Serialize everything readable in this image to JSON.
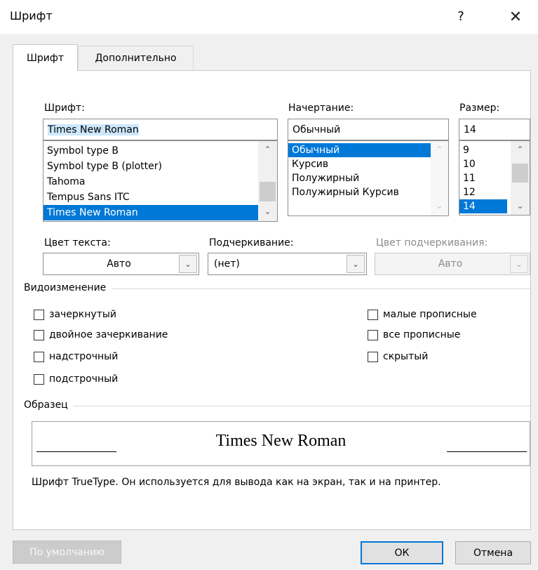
{
  "dialog": {
    "title": "Шрифт",
    "help_label": "?",
    "close_label": "✕"
  },
  "tabs": [
    {
      "label": "Шрифт",
      "active": true
    },
    {
      "label": "Дополнительно",
      "active": false
    }
  ],
  "font": {
    "label": "Шрифт:",
    "value": "Times New Roman",
    "options": [
      "Symbol type B",
      "Symbol type B (plotter)",
      "Tahoma",
      "Tempus Sans ITC",
      "Times New Roman"
    ],
    "selected_index": 4
  },
  "style": {
    "label": "Начертание:",
    "value": "Обычный",
    "options": [
      "Обычный",
      "Курсив",
      "Полужирный",
      "Полужирный Курсив"
    ],
    "selected_index": 0
  },
  "size": {
    "label": "Размер:",
    "value": "14",
    "options": [
      "9",
      "10",
      "11",
      "12",
      "14"
    ],
    "selected_index": 4
  },
  "text_color": {
    "label": "Цвет текста:",
    "value": "Авто"
  },
  "underline": {
    "label": "Подчеркивание:",
    "value": "(нет)"
  },
  "underline_color": {
    "label": "Цвет подчеркивания:",
    "value": "Авто",
    "disabled": true
  },
  "effects": {
    "section_label": "Видоизменение",
    "left": [
      {
        "label": "зачеркнутый",
        "checked": false
      },
      {
        "label": "двойное зачеркивание",
        "checked": false
      },
      {
        "label": "надстрочный",
        "checked": false
      },
      {
        "label": "подстрочный",
        "checked": false
      }
    ],
    "right": [
      {
        "label": "малые прописные",
        "checked": false
      },
      {
        "label": "все прописные",
        "checked": false
      },
      {
        "label": "скрытый",
        "checked": false
      }
    ]
  },
  "preview": {
    "section_label": "Образец",
    "text": "Times New Roman",
    "note": "Шрифт TrueType. Он используется для вывода как на экран, так и на принтер."
  },
  "buttons": {
    "default": "По умолчанию",
    "ok": "ОК",
    "cancel": "Отмена"
  },
  "colors": {
    "selection": "#0078d7",
    "default_button_border": "#0078d7"
  }
}
